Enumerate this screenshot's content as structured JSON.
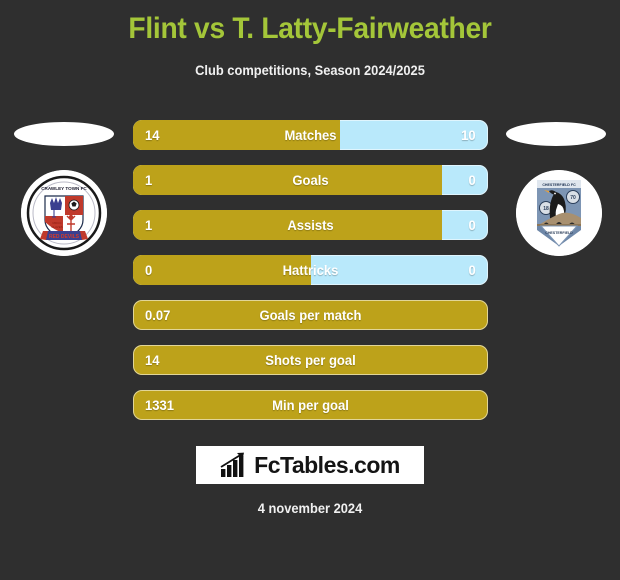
{
  "header": {
    "title": "Flint vs T. Latty-Fairweather",
    "subtitle": "Club competitions, Season 2024/2025",
    "title_color": "#a4c639"
  },
  "teams": {
    "home": {
      "name": "Crawley Town FC",
      "badge_name": "crawley-town-badge",
      "badge_text_top": "CRAWLEY TOWN FC",
      "badge_text_bottom": "RED DEVILS"
    },
    "away": {
      "name": "Chesterfield FC",
      "badge_name": "chesterfield-badge",
      "badge_text_top": "CHESTERFIELD FC",
      "badge_text_bottom": "CHESTERFIELD"
    }
  },
  "colors": {
    "background": "#2f2f2f",
    "bar_left": "#bda21a",
    "bar_right": "#b9e9fb",
    "title": "#a4c639",
    "text": "#ffffff"
  },
  "chart_data": {
    "type": "bar",
    "title": "Flint vs T. Latty-Fairweather",
    "subtitle": "Club competitions, Season 2024/2025",
    "legend": [
      "Flint",
      "T. Latty-Fairweather"
    ],
    "categories": [
      "Matches",
      "Goals",
      "Assists",
      "Hattricks",
      "Goals per match",
      "Shots per goal",
      "Min per goal"
    ],
    "series": [
      {
        "name": "Flint",
        "values": [
          14,
          1,
          1,
          0,
          0.07,
          14,
          1331
        ]
      },
      {
        "name": "T. Latty-Fairweather",
        "values": [
          10,
          0,
          0,
          0,
          null,
          null,
          null
        ]
      }
    ],
    "grid": false,
    "legend_position": "none"
  },
  "rows": [
    {
      "label": "Matches",
      "left": "14",
      "right": "10",
      "left_pct": 58.3,
      "has_right": true
    },
    {
      "label": "Goals",
      "left": "1",
      "right": "0",
      "left_pct": 87.0,
      "has_right": true
    },
    {
      "label": "Assists",
      "left": "1",
      "right": "0",
      "left_pct": 87.0,
      "has_right": true
    },
    {
      "label": "Hattricks",
      "left": "0",
      "right": "0",
      "left_pct": 50.0,
      "has_right": true
    },
    {
      "label": "Goals per match",
      "left": "0.07",
      "right": "",
      "left_pct": 100,
      "has_right": false
    },
    {
      "label": "Shots per goal",
      "left": "14",
      "right": "",
      "left_pct": 100,
      "has_right": false
    },
    {
      "label": "Min per goal",
      "left": "1331",
      "right": "",
      "left_pct": 100,
      "has_right": false
    }
  ],
  "footer": {
    "logo_text": "FcTables.com",
    "logo_icon": "bar-chart-icon",
    "date": "4 november 2024"
  }
}
